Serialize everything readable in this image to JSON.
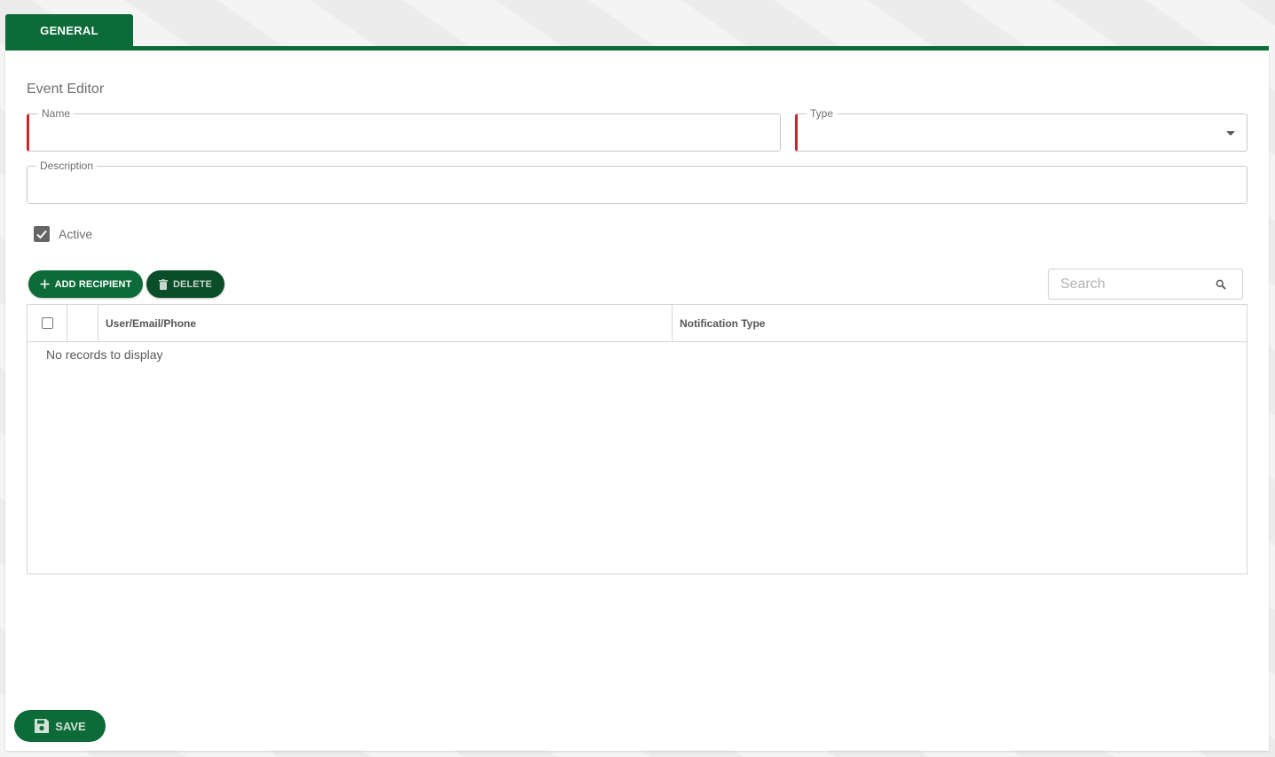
{
  "tabs": [
    {
      "label": "GENERAL"
    }
  ],
  "editor": {
    "title": "Event Editor",
    "name_field": {
      "label": "Name",
      "value": ""
    },
    "type_field": {
      "label": "Type",
      "value": ""
    },
    "description_field": {
      "label": "Description",
      "value": ""
    },
    "active": {
      "label": "Active",
      "checked": true
    }
  },
  "toolbar": {
    "add_recipient_label": "ADD RECIPIENT",
    "delete_label": "DELETE",
    "search_placeholder": "Search"
  },
  "grid": {
    "columns": [
      "",
      "",
      "User/Email/Phone",
      "Notification Type"
    ],
    "empty_message": "No records to display"
  },
  "footer": {
    "save_label": "SAVE"
  },
  "colors": {
    "brand_green": "#0c6b38",
    "dark_green": "#0a4d29",
    "required_red": "#c9252c"
  }
}
